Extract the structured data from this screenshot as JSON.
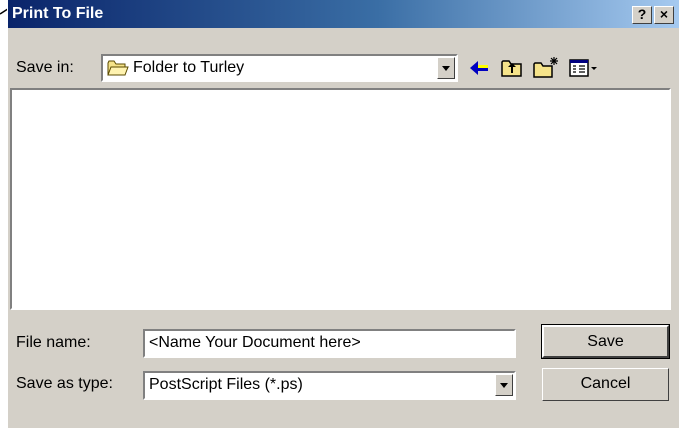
{
  "window": {
    "title": "Print To File"
  },
  "title_buttons": {
    "help": "?",
    "close": "×"
  },
  "save_in": {
    "label": "Save in:",
    "value": "Folder to Turley"
  },
  "toolbar": {
    "icons": [
      "back-arrow-icon",
      "up-one-level-icon",
      "new-folder-icon",
      "view-menu-icon"
    ]
  },
  "file_name": {
    "label": "File name:",
    "value": "<Name Your Document here>"
  },
  "save_as_type": {
    "label": "Save as type:",
    "value": "PostScript Files (*.ps)"
  },
  "buttons": {
    "save": "Save",
    "cancel": "Cancel"
  },
  "colors": {
    "titlebar_start": "#0a246a",
    "titlebar_end": "#a6caf0",
    "face": "#d4d0c8"
  }
}
